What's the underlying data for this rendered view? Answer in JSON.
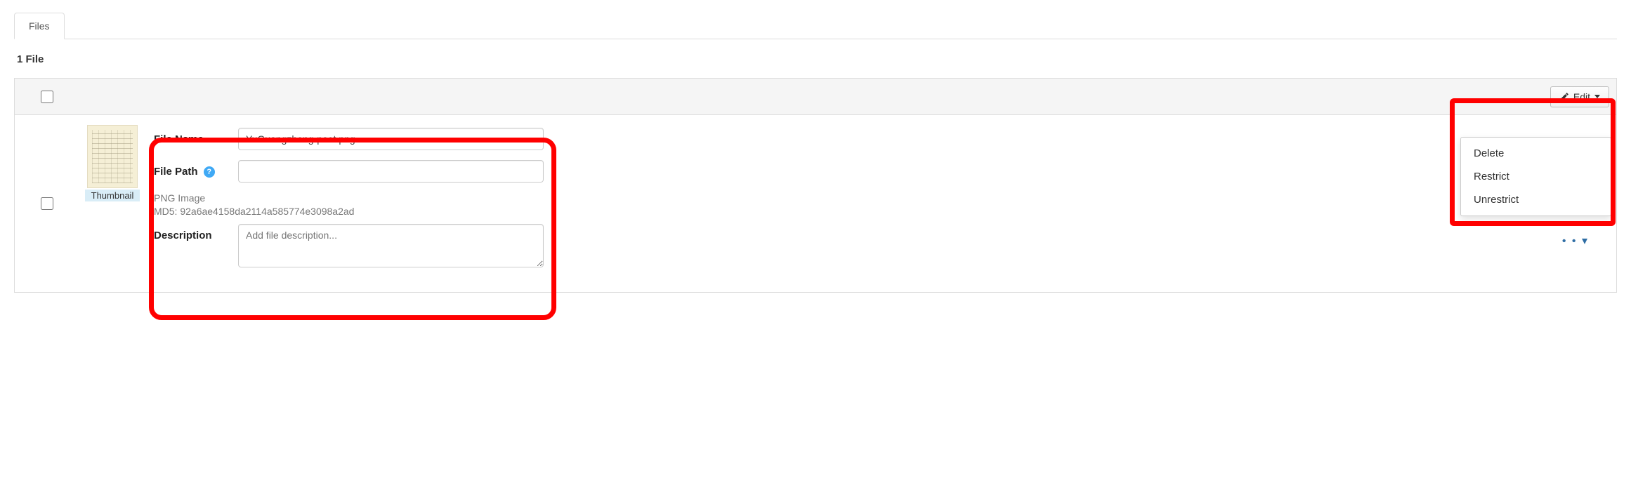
{
  "tabs": {
    "files": "Files"
  },
  "count_label": "1 File",
  "thumbnail_label": "Thumbnail",
  "labels": {
    "file_name": "File Name",
    "file_path": "File Path",
    "description": "Description"
  },
  "file": {
    "name": "YuGuangzhong-poet.png",
    "path": "",
    "type_line": "PNG Image",
    "md5_line": "MD5: 92a6ae4158da2114a585774e3098a2ad",
    "description": ""
  },
  "placeholders": {
    "description": "Add file description..."
  },
  "edit_button": "Edit",
  "menu": {
    "delete": "Delete",
    "restrict": "Restrict",
    "unrestrict": "Unrestrict"
  }
}
